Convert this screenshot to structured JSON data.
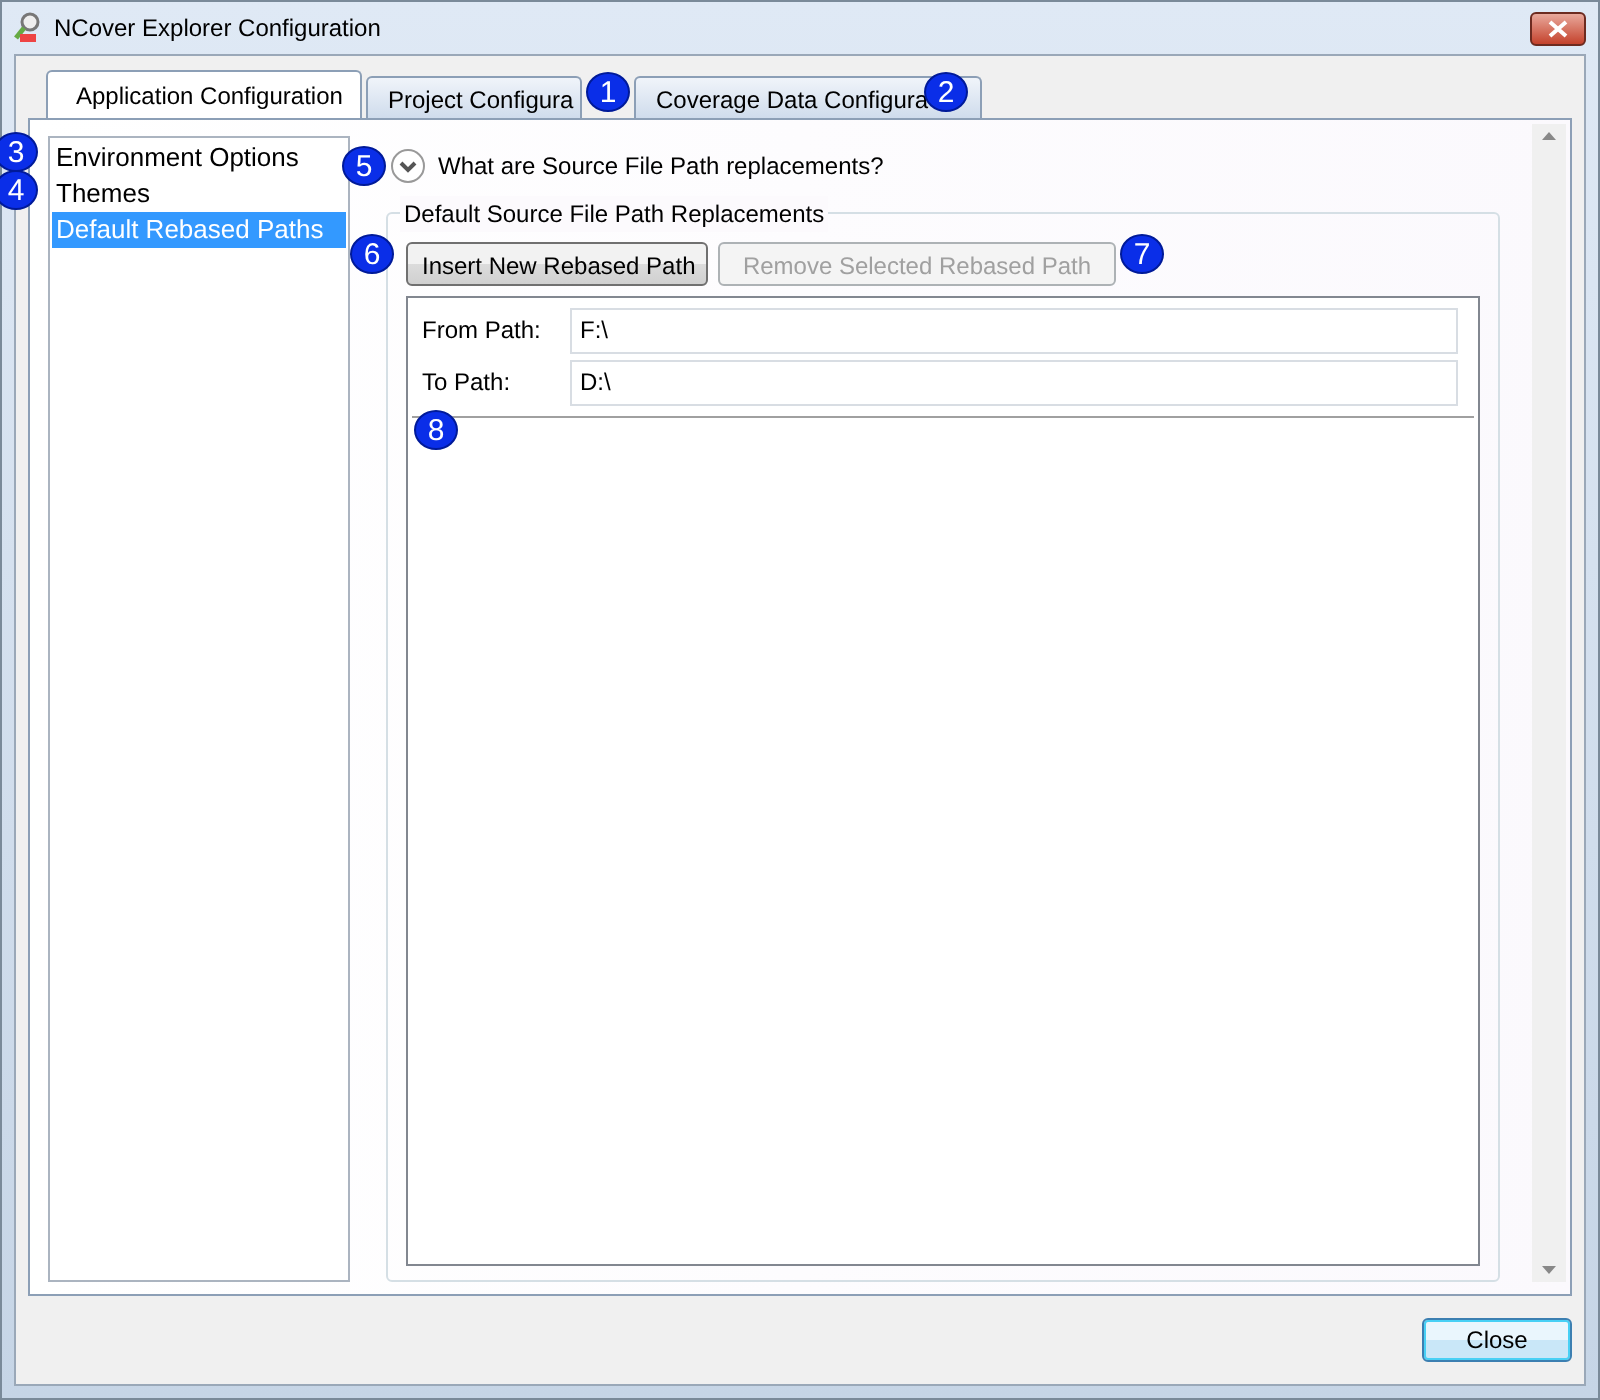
{
  "window": {
    "title": "NCover Explorer Configuration"
  },
  "tabs": [
    {
      "label": "Application Configuration",
      "selected": true
    },
    {
      "label": "Project Configura",
      "selected": false
    },
    {
      "label": "Coverage Data Configura",
      "selected": false
    }
  ],
  "sidebar": {
    "items": [
      {
        "label": "Environment Options",
        "selected": false
      },
      {
        "label": "Themes",
        "selected": false
      },
      {
        "label": "Default Rebased Paths",
        "selected": true
      }
    ]
  },
  "expander": {
    "label": "What are Source File Path replacements?",
    "expanded": false
  },
  "group": {
    "title": "Default Source File Path Replacements",
    "buttons": [
      {
        "label": "Insert New Rebased Path",
        "disabled": false
      },
      {
        "label": "Remove Selected Rebased Path",
        "disabled": true
      }
    ],
    "rows": [
      {
        "label": "From Path:",
        "value": "F:\\"
      },
      {
        "label": "To Path:",
        "value": "D:\\"
      }
    ]
  },
  "callouts": [
    "1",
    "2",
    "3",
    "4",
    "5",
    "6",
    "7",
    "8"
  ],
  "footer_button": {
    "label": "Close"
  }
}
